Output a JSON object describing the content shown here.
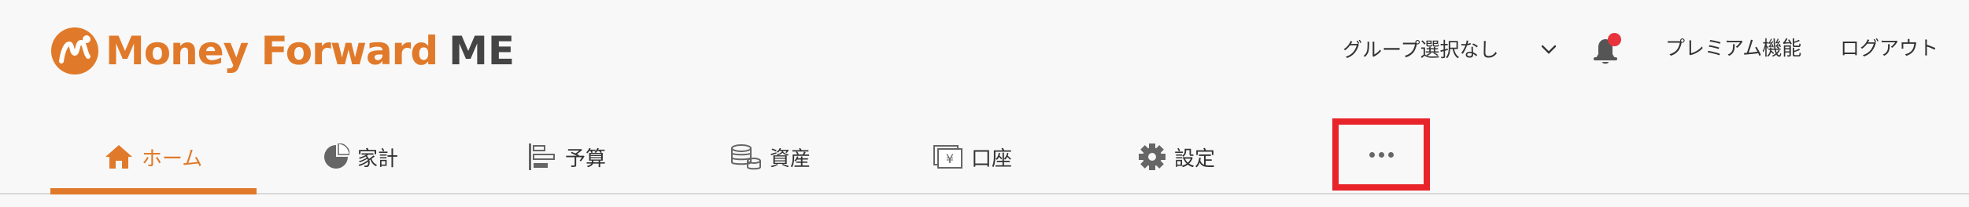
{
  "logo": {
    "text": "Money Forward",
    "suffix": "ME"
  },
  "topbar": {
    "group_select": "グループ選択なし",
    "premium": "プレミアム機能",
    "logout": "ログアウト"
  },
  "nav": {
    "items": [
      {
        "label": "ホーム",
        "icon": "home-icon"
      },
      {
        "label": "家計",
        "icon": "pie-chart-icon"
      },
      {
        "label": "予算",
        "icon": "budget-bars-icon"
      },
      {
        "label": "資産",
        "icon": "coins-stack-icon"
      },
      {
        "label": "口座",
        "icon": "yen-card-icon"
      },
      {
        "label": "設定",
        "icon": "gear-icon"
      }
    ],
    "more_icon": "more-dots-icon"
  },
  "colors": {
    "brand": "#e07a2a",
    "notification": "#e8323c",
    "highlight_border": "#e8242a"
  }
}
